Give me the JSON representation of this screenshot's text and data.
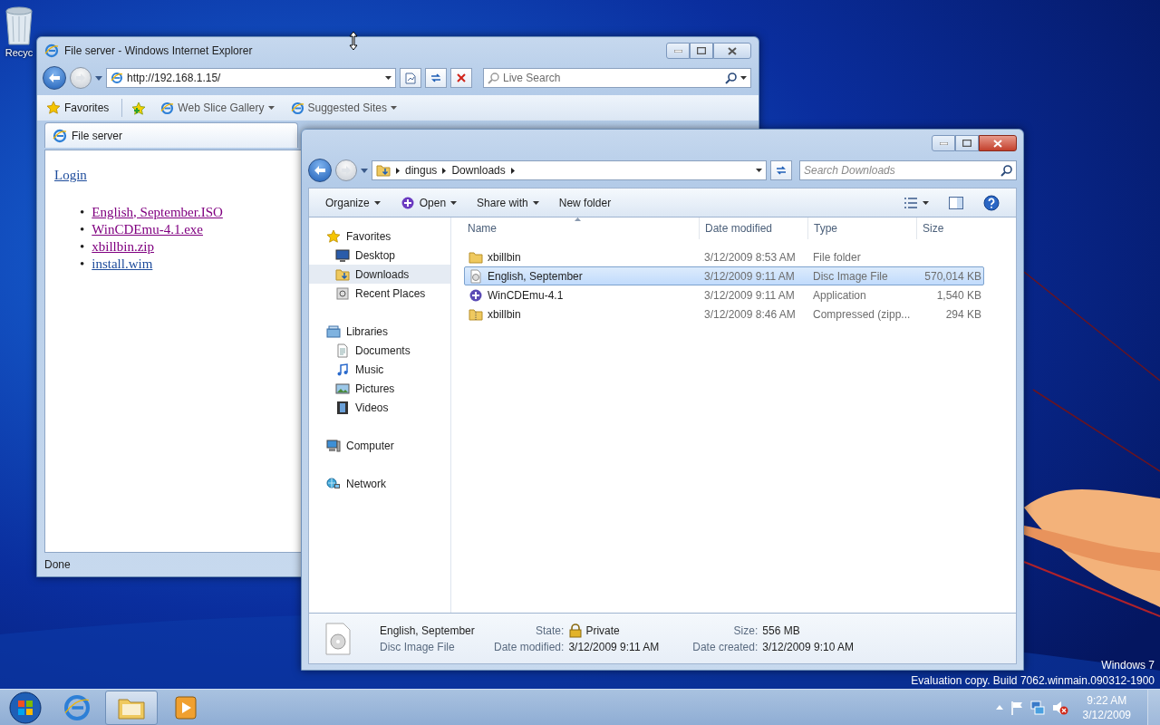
{
  "desktop": {
    "recycle_label": "Recyc",
    "watermark": [
      "Windows 7",
      "Evaluation copy. Build 7062.winmain.090312-1900"
    ]
  },
  "ie": {
    "title": "File server - Windows Internet Explorer",
    "address": "http://192.168.1.15/",
    "search_placeholder": "Live Search",
    "favorites_bar": [
      {
        "label": "Favorites",
        "kind": "favorites",
        "dropdown": false
      },
      {
        "label": "Web Slice Gallery",
        "kind": "page",
        "dropdown": true
      },
      {
        "label": "Suggested Sites",
        "kind": "page",
        "dropdown": true
      }
    ],
    "tab": "File server",
    "page": {
      "login": "Login",
      "links": [
        {
          "marker": "•",
          "label": "English, September.ISO",
          "visited": true
        },
        {
          "marker": "•",
          "label": "WinCDEmu-4.1.exe",
          "visited": true
        },
        {
          "marker": "•",
          "label": "xbillbin.zip",
          "visited": true
        },
        {
          "marker": "•",
          "label": "install.wim",
          "visited": false
        }
      ]
    },
    "status": "Done"
  },
  "explorer": {
    "breadcrumb": [
      "dingus",
      "Downloads"
    ],
    "search_placeholder": "Search Downloads",
    "toolbar": [
      {
        "label": "Organize",
        "kind": "plain",
        "dropdown": true
      },
      {
        "label": "Open",
        "kind": "open",
        "dropdown": true
      },
      {
        "label": "Share with",
        "kind": "plain",
        "dropdown": true
      },
      {
        "label": "New folder",
        "kind": "plain",
        "dropdown": false
      }
    ],
    "nav": [
      {
        "label": "Favorites",
        "kind": "star",
        "selected": false,
        "children": [
          {
            "label": "Desktop",
            "kind": "desktop",
            "selected": false
          },
          {
            "label": "Downloads",
            "kind": "downloads",
            "selected": true
          },
          {
            "label": "Recent Places",
            "kind": "recent",
            "selected": false
          }
        ]
      },
      {
        "label": "Libraries",
        "kind": "libraries",
        "selected": false,
        "children": [
          {
            "label": "Documents",
            "kind": "documents",
            "selected": false
          },
          {
            "label": "Music",
            "kind": "music",
            "selected": false
          },
          {
            "label": "Pictures",
            "kind": "pictures",
            "selected": false
          },
          {
            "label": "Videos",
            "kind": "videos",
            "selected": false
          }
        ]
      },
      {
        "label": "Computer",
        "kind": "computer",
        "selected": false
      },
      {
        "label": "Network",
        "kind": "network",
        "selected": false
      }
    ],
    "columns": [
      "Name",
      "Date modified",
      "Type",
      "Size"
    ],
    "rows": [
      {
        "name": "xbillbin",
        "date": "3/12/2009 8:53 AM",
        "type": "File folder",
        "size": "",
        "kind": "folder",
        "selected": false
      },
      {
        "name": "English, September",
        "date": "3/12/2009 9:11 AM",
        "type": "Disc Image File",
        "size": "570,014 KB",
        "kind": "disc",
        "selected": true
      },
      {
        "name": "WinCDEmu-4.1",
        "date": "3/12/2009 9:11 AM",
        "type": "Application",
        "size": "1,540 KB",
        "kind": "app",
        "selected": false
      },
      {
        "name": "xbillbin",
        "date": "3/12/2009 8:46 AM",
        "type": "Compressed (zipp...",
        "size": "294 KB",
        "kind": "zip",
        "selected": false
      }
    ],
    "details": {
      "name": "English, September",
      "type": "Disc Image File",
      "fields": [
        {
          "label": "State:",
          "value": "Private",
          "kind": "lock"
        },
        {
          "label": "Size:",
          "value": "556 MB",
          "kind": "plain"
        },
        {
          "label": "Date modified:",
          "value": "3/12/2009 9:11 AM",
          "kind": "plain"
        },
        {
          "label": "Date created:",
          "value": "3/12/2009 9:10 AM",
          "kind": "plain"
        }
      ]
    }
  },
  "taskbar": {
    "apps": [
      {
        "kind": "ie",
        "selected": false
      },
      {
        "kind": "explorer",
        "selected": true
      },
      {
        "kind": "media",
        "selected": false
      }
    ],
    "time": "9:22 AM",
    "date": "3/12/2009"
  }
}
